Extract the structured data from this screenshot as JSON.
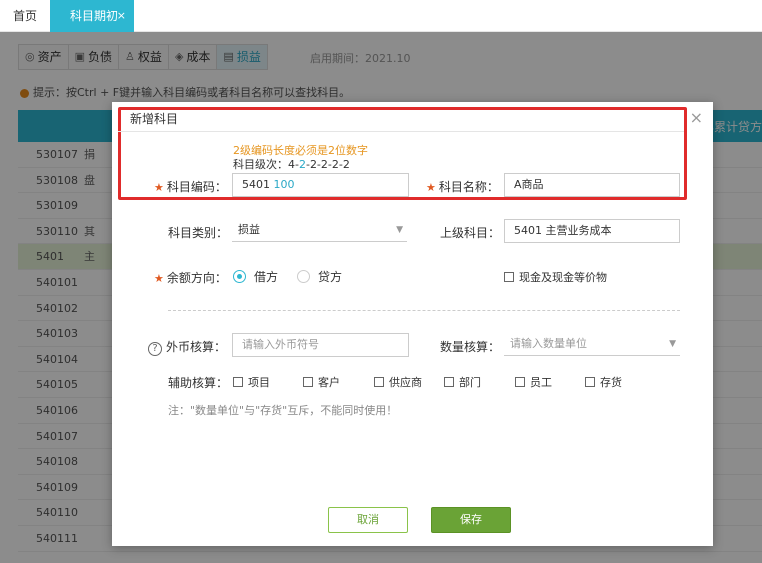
{
  "tabs": {
    "home": "首页",
    "active": "科目期初",
    "close": "×"
  },
  "category_tabs": [
    {
      "label": "资产",
      "icon": "asset-icon"
    },
    {
      "label": "负债",
      "icon": "liability-icon"
    },
    {
      "label": "权益",
      "icon": "equity-icon"
    },
    {
      "label": "成本",
      "icon": "cost-icon"
    },
    {
      "label": "损益",
      "icon": "profit-loss-icon"
    }
  ],
  "period_label": "启用期间：2021.10",
  "tip": "提示：按Ctrl + F键并输入科目编码或者科目名称可以查找科目。",
  "table_header_right": "年累计贷方",
  "rows": [
    {
      "code": "530107",
      "extra": "捐"
    },
    {
      "code": "530108",
      "extra": "盘"
    },
    {
      "code": "530109",
      "extra": ""
    },
    {
      "code": "530110",
      "extra": "其"
    },
    {
      "code": "5401",
      "extra": "主"
    },
    {
      "code": "540101",
      "extra": ""
    },
    {
      "code": "540102",
      "extra": ""
    },
    {
      "code": "540103",
      "extra": ""
    },
    {
      "code": "540104",
      "extra": ""
    },
    {
      "code": "540105",
      "extra": ""
    },
    {
      "code": "540106",
      "extra": ""
    },
    {
      "code": "540107",
      "extra": ""
    },
    {
      "code": "540108",
      "extra": ""
    },
    {
      "code": "540109",
      "extra": ""
    },
    {
      "code": "540110",
      "extra": ""
    },
    {
      "code": "540111",
      "extra": ""
    }
  ],
  "modal": {
    "title": "新增科目",
    "close": "×",
    "hint_length": "2级编码长度必须是2位数字",
    "hint_levels_prefix": "科目级次：4-",
    "hint_levels_highlight": "2",
    "hint_levels_suffix": "-2-2-2-2",
    "code_label": "科目编码：",
    "code_prefix": "5401",
    "code_suffix": "100",
    "name_label": "科目名称：",
    "name_value": "A商品",
    "type_label": "科目类别：",
    "type_value": "损益",
    "parent_label": "上级科目：",
    "parent_value": "5401 主营业务成本",
    "direction_label": "余额方向：",
    "debit": "借方",
    "credit": "贷方",
    "cash_equiv": "现金及现金等价物",
    "fx_label": "外币核算：",
    "fx_placeholder": "请输入外币符号",
    "qty_label": "数量核算：",
    "qty_placeholder": "请输入数量单位",
    "aux_label": "辅助核算：",
    "aux_items": [
      "项目",
      "客户",
      "供应商",
      "部门",
      "员工",
      "存货"
    ],
    "note": "注：\"数量单位\"与\"存货\"互斥，不能同时使用！",
    "cancel": "取消",
    "save": "保存"
  },
  "colors": {
    "accent": "#2db7d1",
    "save_green": "#6aa336",
    "required_star": "#e05a22",
    "hint_orange": "#e6951f",
    "highlight_red": "#e02b2b"
  }
}
